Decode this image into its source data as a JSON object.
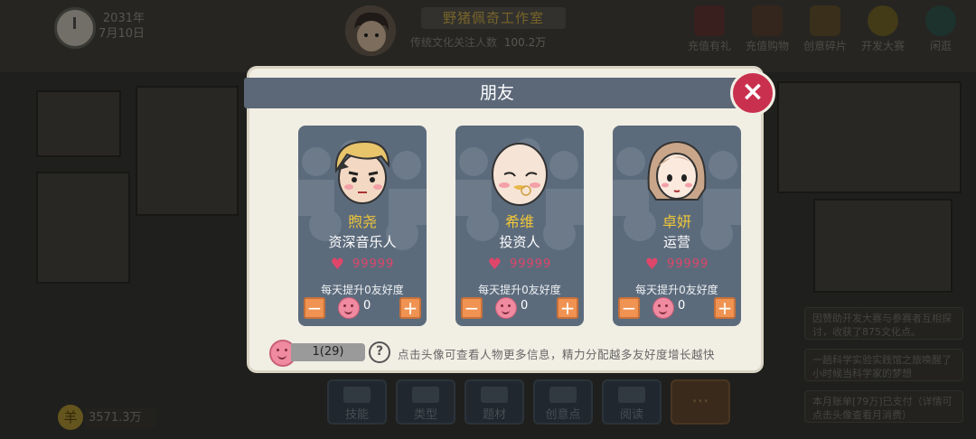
{
  "hud": {
    "year": "2031年",
    "day": "7月10日",
    "studio_name": "野猪佩奇工作室",
    "fans_label": "传统文化关注人数",
    "fans_value": "100.2万",
    "menu": [
      {
        "label": "充值有礼",
        "icon": "gift-box-icon",
        "color": "#8a3b3b"
      },
      {
        "label": "充值购物",
        "icon": "shop-icon",
        "color": "#7a4f3a"
      },
      {
        "label": "创意碎片",
        "icon": "gift-ribbon-icon",
        "color": "#8a6a2e"
      },
      {
        "label": "开发大赛",
        "icon": "code-badge-icon",
        "color": "#9c8424"
      },
      {
        "label": "闲逛",
        "icon": "tree-icon",
        "color": "#3c6b5e"
      }
    ]
  },
  "bottom": {
    "money": "3571.3万",
    "coin_symbol": "羊",
    "buttons": [
      "技能",
      "类型",
      "题材",
      "创意点",
      "阅读"
    ],
    "more": "···"
  },
  "side_messages": [
    "因赞助开发大赛与参赛者互相探讨，收获了875文化点。",
    "一趟科学实验实践馆之旅唤醒了小时候当科学家的梦想",
    "本月账单[79万]已支付（详情可点击头像查看月消费）"
  ],
  "dialog": {
    "title": "朋友",
    "close_label": "×",
    "friends": [
      {
        "name": "煦尧",
        "role": "资深音乐人",
        "affection": "99999",
        "daily": "每天提升0友好度",
        "allocated": "0"
      },
      {
        "name": "希维",
        "role": "投资人",
        "affection": "99999",
        "daily": "每天提升0友好度",
        "allocated": "0"
      },
      {
        "name": "卓妍",
        "role": "运营",
        "affection": "99999",
        "daily": "每天提升0友好度",
        "allocated": "0"
      }
    ],
    "energy": "1(29)",
    "help": "?",
    "hint": "点击头像可查看人物更多信息，精力分配越多友好度增长越快"
  }
}
